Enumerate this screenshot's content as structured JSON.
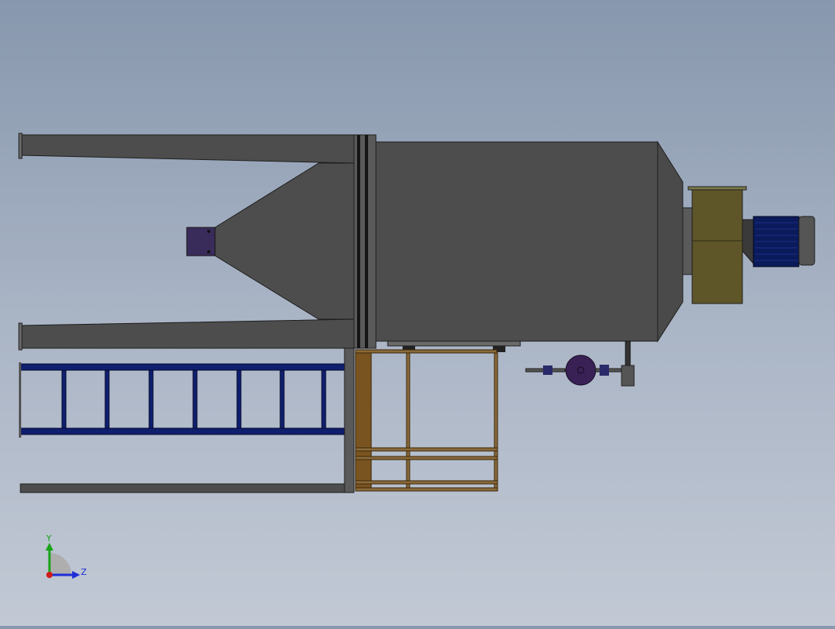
{
  "triad": {
    "y_label": "Y",
    "z_label": "Z",
    "y_color": "#19a319",
    "z_color": "#1f2fd6",
    "x_color": "#d11a1a"
  },
  "colors": {
    "background_top": "#8797ad",
    "background_bottom": "#c2c9d5",
    "steel_body": "#4d4d4d",
    "steel_edge": "#1e1e1e",
    "ladder": "#0f1f6e",
    "wood_frame": "#7a5420",
    "fan_housing": "#5e5628",
    "motor": "#0a1a5a",
    "outlet_flange": "#3a2c5a",
    "valve": "#3a2155"
  }
}
